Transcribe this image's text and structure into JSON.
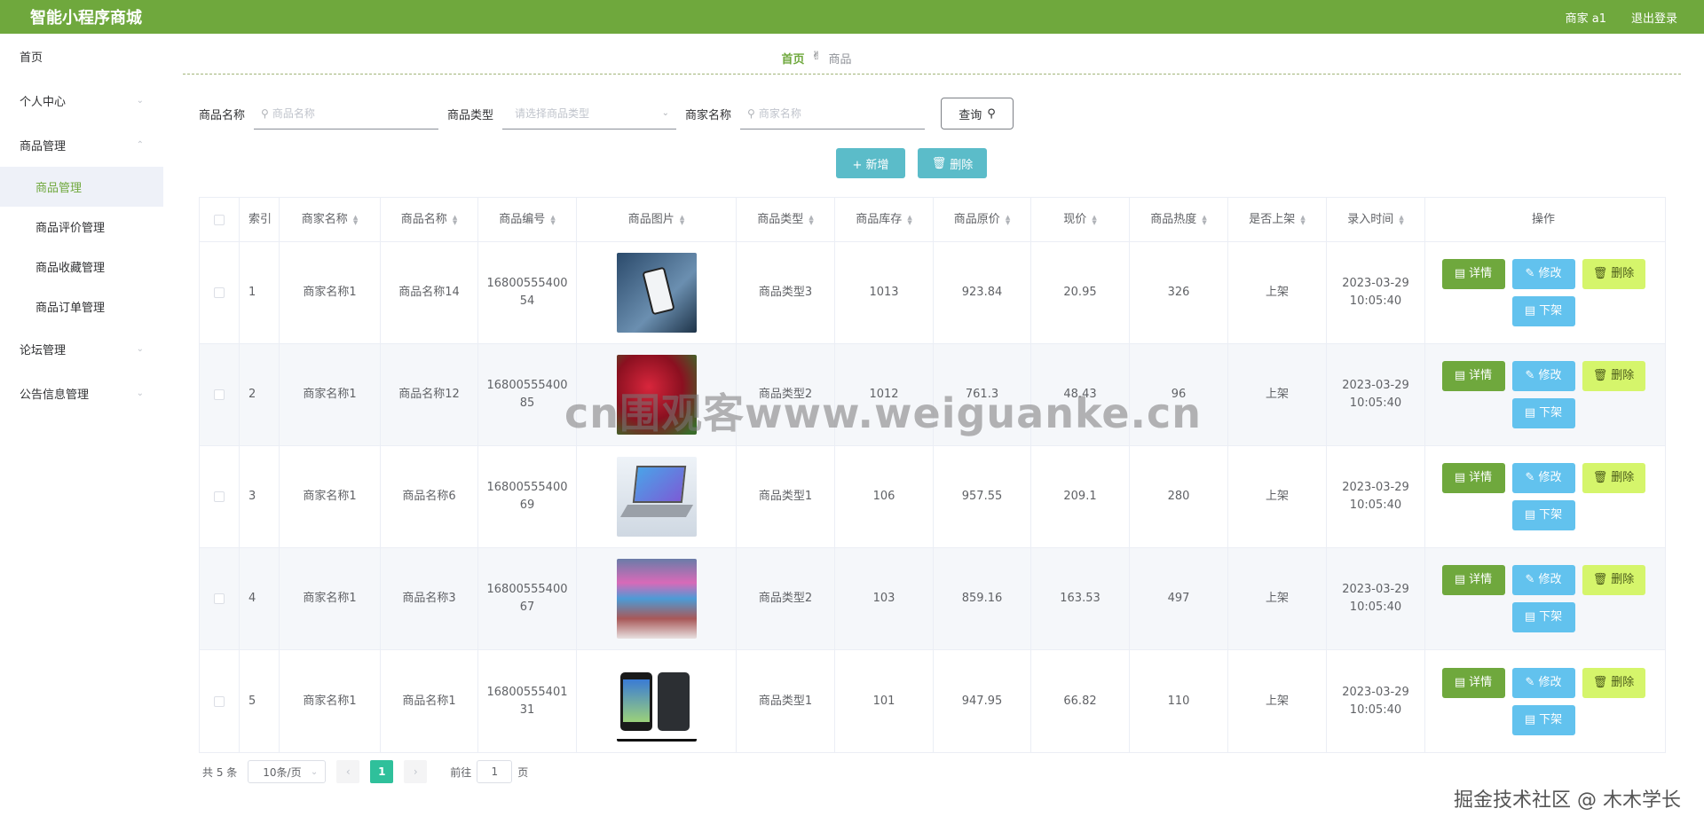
{
  "header": {
    "title": "智能小程序商城",
    "user": "商家 a1",
    "logout": "退出登录"
  },
  "sidebar": {
    "items": [
      {
        "label": "首页"
      },
      {
        "label": "个人中心"
      },
      {
        "label": "商品管理"
      },
      {
        "label": "论坛管理"
      },
      {
        "label": "公告信息管理"
      }
    ],
    "sub_items": [
      {
        "label": "商品管理"
      },
      {
        "label": "商品评价管理"
      },
      {
        "label": "商品收藏管理"
      },
      {
        "label": "商品订单管理"
      }
    ]
  },
  "breadcrumb": {
    "home": "首页",
    "current": "商品"
  },
  "search": {
    "name_label": "商品名称",
    "name_placeholder": "商品名称",
    "type_label": "商品类型",
    "type_placeholder": "请选择商品类型",
    "merchant_label": "商家名称",
    "merchant_placeholder": "商家名称",
    "query_label": "查询"
  },
  "actions": {
    "add_label": "+ 新增",
    "delete_label": "删除"
  },
  "table": {
    "headers": [
      "索引",
      "商家名称",
      "商品名称",
      "商品编号",
      "商品图片",
      "商品类型",
      "商品库存",
      "商品原价",
      "现价",
      "商品热度",
      "是否上架",
      "录入时间",
      "操作"
    ],
    "rows": [
      {
        "index": "1",
        "merchant": "商家名称1",
        "name": "商品名称14",
        "code": "1680055540054",
        "type": "商品类型3",
        "stock": "1013",
        "orig": "923.84",
        "now": "20.95",
        "heat": "326",
        "shelf": "上架",
        "time": "2023-03-29 10:05:40"
      },
      {
        "index": "2",
        "merchant": "商家名称1",
        "name": "商品名称12",
        "code": "1680055540085",
        "type": "商品类型2",
        "stock": "1012",
        "orig": "761.3",
        "now": "48.43",
        "heat": "96",
        "shelf": "上架",
        "time": "2023-03-29 10:05:40"
      },
      {
        "index": "3",
        "merchant": "商家名称1",
        "name": "商品名称6",
        "code": "1680055540069",
        "type": "商品类型1",
        "stock": "106",
        "orig": "957.55",
        "now": "209.1",
        "heat": "280",
        "shelf": "上架",
        "time": "2023-03-29 10:05:40"
      },
      {
        "index": "4",
        "merchant": "商家名称1",
        "name": "商品名称3",
        "code": "1680055540067",
        "type": "商品类型2",
        "stock": "103",
        "orig": "859.16",
        "now": "163.53",
        "heat": "497",
        "shelf": "上架",
        "time": "2023-03-29 10:05:40"
      },
      {
        "index": "5",
        "merchant": "商家名称1",
        "name": "商品名称1",
        "code": "1680055540131",
        "type": "商品类型1",
        "stock": "101",
        "orig": "947.95",
        "now": "66.82",
        "heat": "110",
        "shelf": "上架",
        "time": "2023-03-29 10:05:40"
      }
    ],
    "op_labels": {
      "detail": "详情",
      "edit": "修改",
      "delete": "删除",
      "off": "下架"
    }
  },
  "pager": {
    "total": "共 5 条",
    "size": "10条/页",
    "page": "1",
    "goto": "前往",
    "goto_value": "1",
    "page_unit": "页"
  },
  "watermark": {
    "center": "cn围观客www.weiguanke.cn",
    "corner": "掘金技术社区 @ 木木学长"
  },
  "colors": {
    "header": "#6fa83d",
    "accent_green": "#6fa83d",
    "teal": "#5bbcc9",
    "blue": "#62c2ee",
    "lime": "#d5f56b",
    "page_active": "#2fc09b"
  }
}
